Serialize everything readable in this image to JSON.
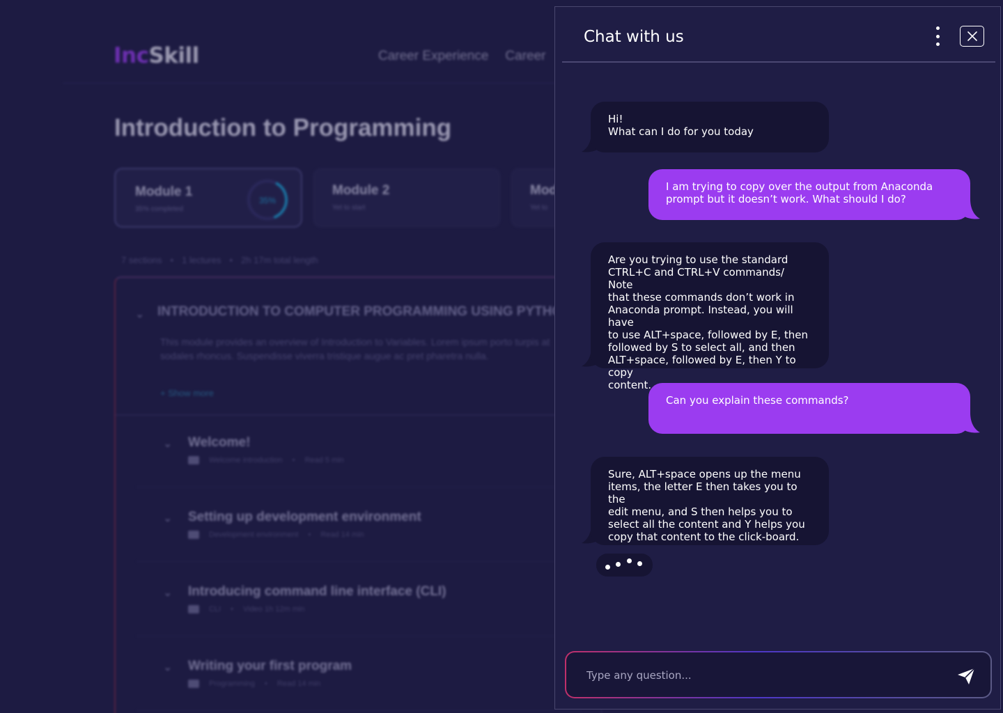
{
  "background": {
    "logo": {
      "part1": "Inc",
      "part2": "Skill"
    },
    "nav": [
      "Career Experience",
      "Career"
    ],
    "page_title": "Introduction to Programming",
    "modules": [
      {
        "title": "Module 1",
        "status": "35% completed",
        "progress_label": "35%",
        "progress": 0.35
      },
      {
        "title": "Module 2",
        "status": "Yet to start"
      },
      {
        "title": "Mod",
        "status": "Yet to"
      }
    ],
    "stats": [
      "7 sections",
      "•",
      "1 lectures",
      "•",
      "2h 17m total length"
    ],
    "section": {
      "title": "INTRODUCTION TO COMPUTER PROGRAMMING USING PYTHON",
      "description": "This module provides an overview of Introduction to Variables. Lorem ipsum porto turpis at sodales rhoncus. Suspendisse viverra tristique augue ac pret pharetra nulla.",
      "show_more": "+ Show more"
    },
    "lectures": [
      {
        "title": "Welcome!",
        "meta": "Welcome introduction",
        "duration": "Read 5 min"
      },
      {
        "title": "Setting up development environment",
        "meta": "Development environment",
        "duration": "Read 14 min"
      },
      {
        "title": "Introducing command line interface (CLI)",
        "meta": "CLI",
        "duration": "Video 1h 12m min"
      },
      {
        "title": "Writing your first program",
        "meta": "Programming",
        "duration": "Read 14 min"
      }
    ]
  },
  "chat": {
    "title": "Chat with us",
    "messages": [
      {
        "from": "bot",
        "text": "Hi!\nWhat can I do for you today"
      },
      {
        "from": "user",
        "text": "I am trying to copy over the output from Anaconda\nprompt but it doesn’t work. What should I do?"
      },
      {
        "from": "bot",
        "text": "Are you trying to use the standard\nCTRL+C and CTRL+V commands/ Note\nthat these commands don’t work in\nAnaconda prompt. Instead, you will have\nto use ALT+space, followed by E, then\nfollowed by S to select all, and then\nALT+space, followed by E, then Y to copy\ncontent."
      },
      {
        "from": "user",
        "text": "Can you explain these commands?"
      },
      {
        "from": "bot",
        "text": "Sure, ALT+space opens up the menu\nitems, the letter E then takes you to the\nedit menu, and S then helps you to\nselect all the content and Y helps you\ncopy that content to the click-board."
      }
    ],
    "input": {
      "placeholder": "Type any question...",
      "value": ""
    },
    "icons": {
      "menu": "more-vertical-icon",
      "close": "close-icon",
      "send": "send-icon"
    },
    "colors": {
      "accent": "#9b3cf0",
      "panel": "#1f1d45",
      "bot_bubble": "#161433"
    }
  }
}
